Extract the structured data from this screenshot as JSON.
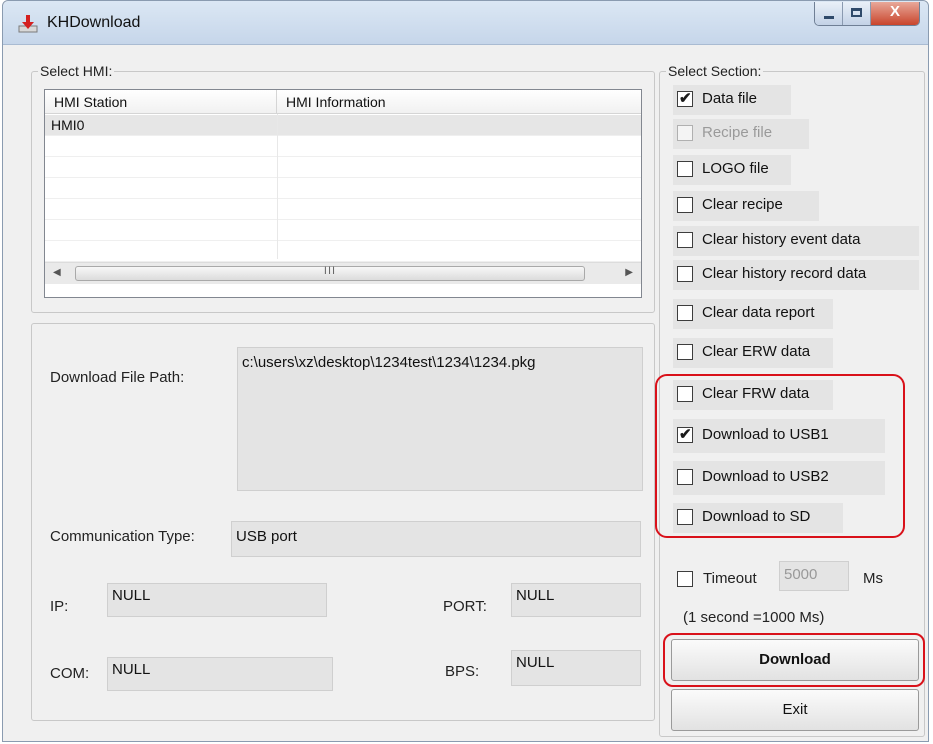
{
  "window": {
    "title": "KHDownload",
    "icon": "download-arrow-icon",
    "controls": {
      "minimize": "minimize-icon",
      "maximize": "maximize-icon",
      "close": "X"
    }
  },
  "select_hmi": {
    "label": "Select HMI:",
    "columns": [
      "HMI Station",
      "HMI Information"
    ],
    "rows": [
      {
        "station": "HMI0",
        "info": ""
      }
    ],
    "scroll_grip": "III"
  },
  "details": {
    "download_path_label": "Download File Path:",
    "download_path_value": "c:\\users\\xz\\desktop\\1234test\\1234\\1234.pkg",
    "comm_type_label": "Communication Type:",
    "comm_type_value": "USB port",
    "ip_label": "IP:",
    "ip_value": "NULL",
    "port_label": "PORT:",
    "port_value": "NULL",
    "com_label": "COM:",
    "com_value": "NULL",
    "bps_label": "BPS:",
    "bps_value": "NULL"
  },
  "select_section": {
    "label": "Select Section:",
    "options": [
      {
        "label": "Data file",
        "checked": true,
        "enabled": true
      },
      {
        "label": "Recipe file",
        "checked": false,
        "enabled": false
      },
      {
        "label": "LOGO file",
        "checked": false,
        "enabled": true
      },
      {
        "label": "Clear recipe",
        "checked": false,
        "enabled": true
      },
      {
        "label": "Clear history event data",
        "checked": false,
        "enabled": true
      },
      {
        "label": "Clear history record data",
        "checked": false,
        "enabled": true
      },
      {
        "label": "Clear data report",
        "checked": false,
        "enabled": true
      },
      {
        "label": "Clear ERW data",
        "checked": false,
        "enabled": true
      },
      {
        "label": "Clear FRW data",
        "checked": false,
        "enabled": true
      },
      {
        "label": "Download to USB1",
        "checked": true,
        "enabled": true
      },
      {
        "label": "Download to USB2",
        "checked": false,
        "enabled": true
      },
      {
        "label": "Download to SD",
        "checked": false,
        "enabled": true
      }
    ],
    "check_glyph": "✔"
  },
  "timeout": {
    "label": "Timeout",
    "checked": false,
    "value": "5000",
    "unit": "Ms",
    "note": "(1 second =1000 Ms)"
  },
  "buttons": {
    "download": "Download",
    "exit": "Exit"
  },
  "colors": {
    "highlight": "#d9111a",
    "window_bg": "#f0f0f0"
  }
}
